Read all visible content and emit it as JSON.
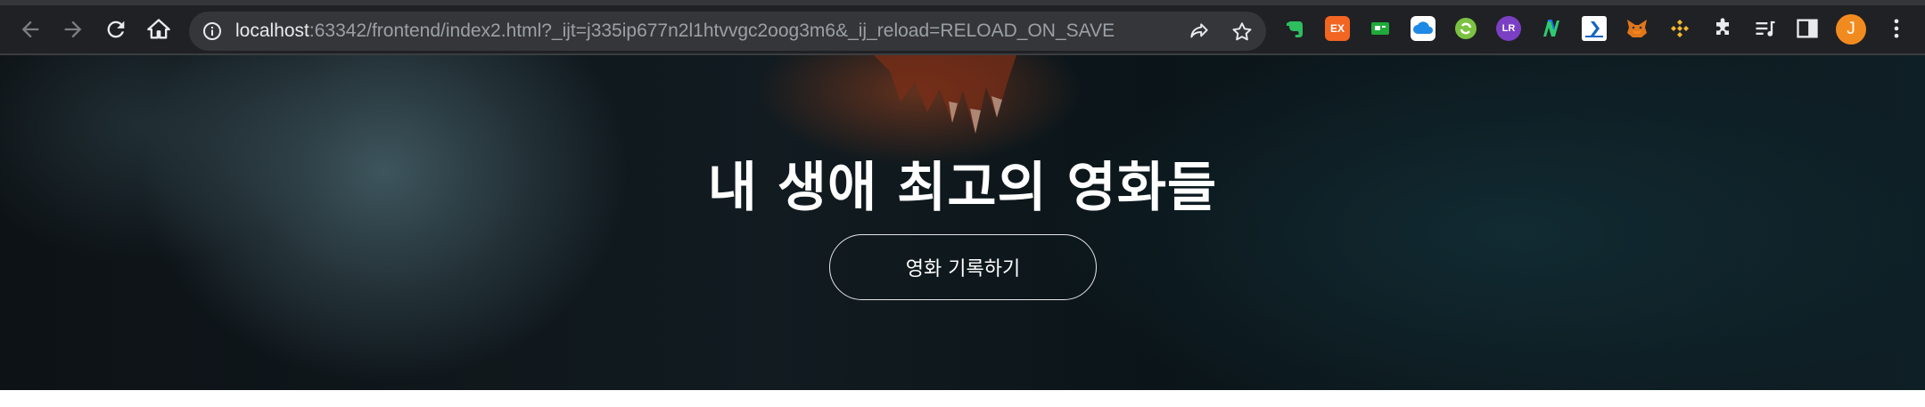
{
  "browser": {
    "url_host": "localhost",
    "url_rest": ":63342/frontend/index2.html?_ijt=j335ip677n2l1htvvgc2oog3m6&_ij_reload=RELOAD_ON_SAVE",
    "profile_initial": "J",
    "extensions": [
      "evernote-icon",
      "ex-extension-icon",
      "green-extension-icon",
      "cloud-extension-icon",
      "refresh-extension-icon",
      "lr-extension-icon",
      "n-extension-icon",
      "doc-extension-icon",
      "metamask-icon",
      "binance-icon"
    ],
    "ex_label": "EX",
    "lr_label": "LR"
  },
  "hero": {
    "title": "내 생애 최고의 영화들",
    "button_label": "영화 기록하기"
  },
  "colors": {
    "chrome_bg": "#202124",
    "omnibox_bg": "#35363a",
    "avatar": "#f28b1f",
    "hero_text": "#ffffff"
  }
}
